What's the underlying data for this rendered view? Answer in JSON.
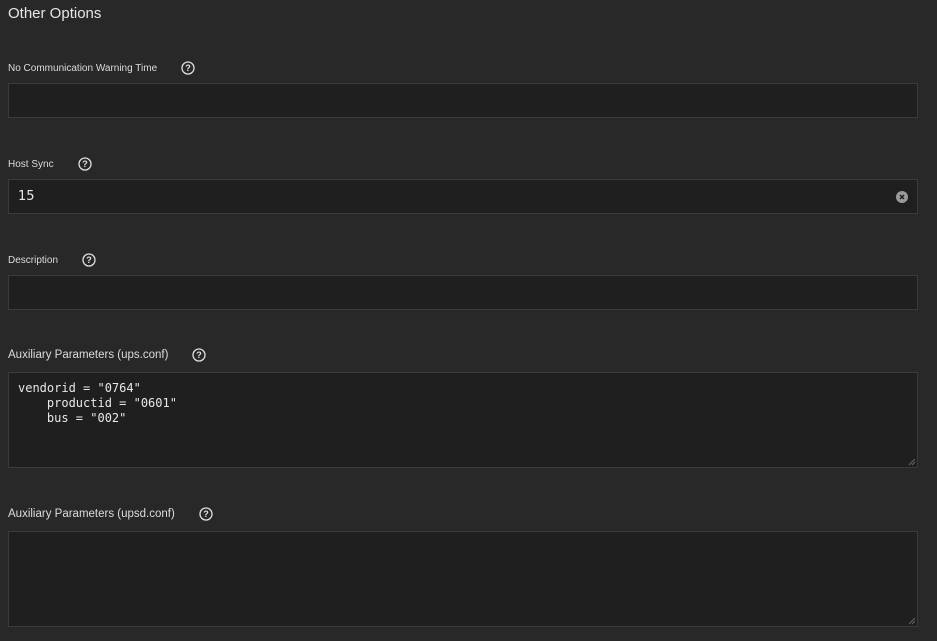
{
  "section": {
    "title": "Other Options"
  },
  "fields": [
    {
      "label": "No Communication Warning Time",
      "value": ""
    },
    {
      "label": "Host Sync",
      "value": "15"
    },
    {
      "label": "Description",
      "value": ""
    },
    {
      "label": "Auxiliary Parameters (ups.conf)",
      "value": "vendorid = \"0764\"\n    productid = \"0601\"\n    bus = \"002\""
    },
    {
      "label": "Auxiliary Parameters (upsd.conf)",
      "value": ""
    }
  ],
  "icons": {
    "help": "help-circle-icon",
    "clear": "clear-icon",
    "resize": "resize-grip-icon"
  }
}
